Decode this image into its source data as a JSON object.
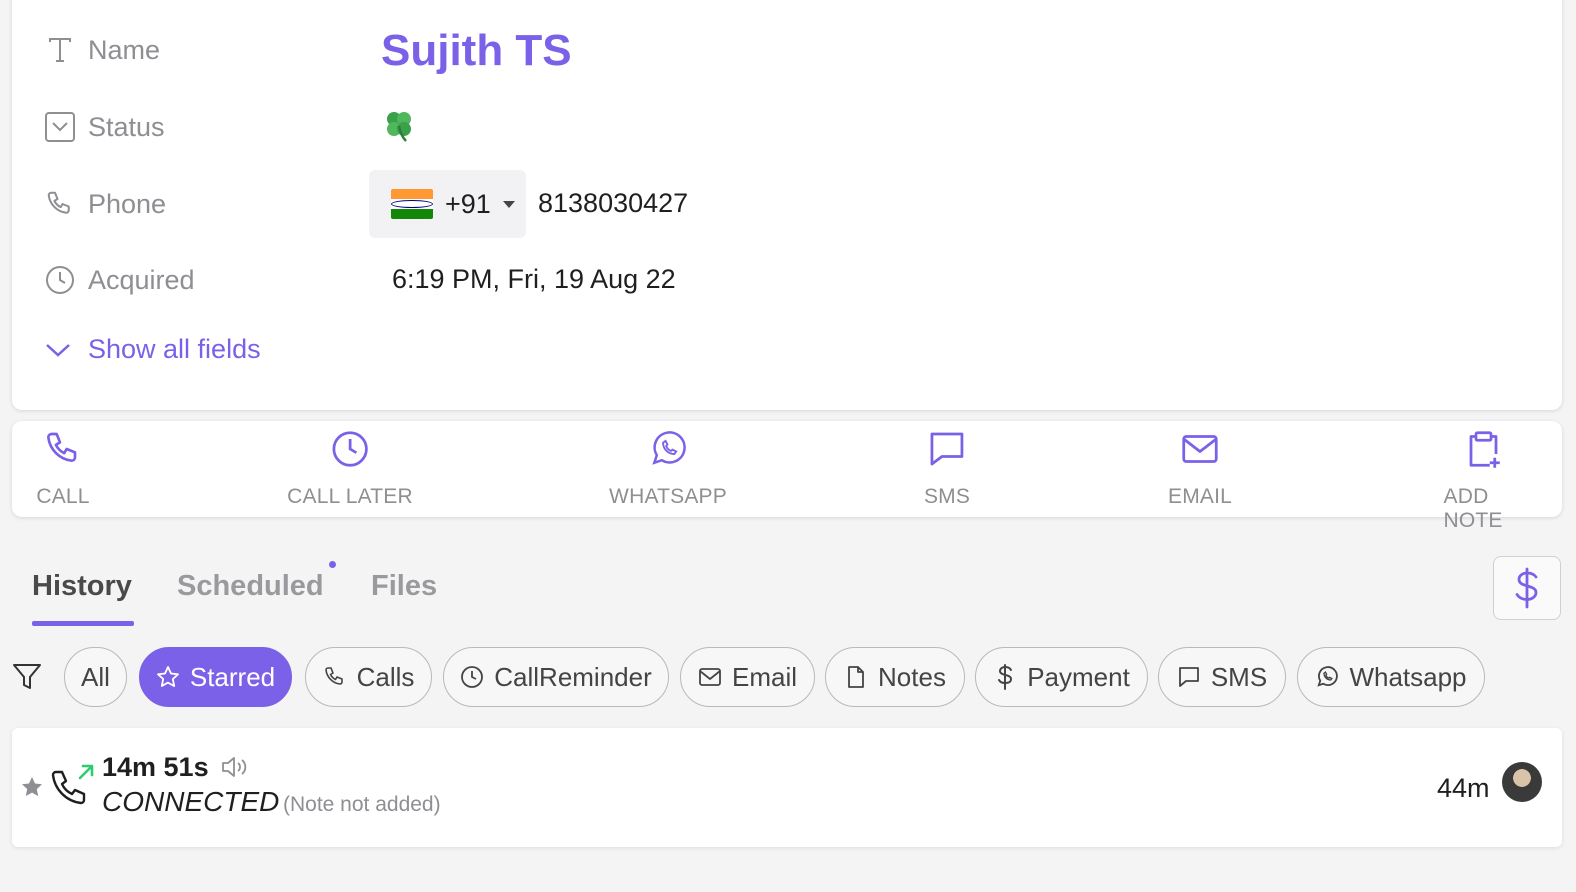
{
  "contact": {
    "fields": {
      "name_label": "Name",
      "status_label": "Status",
      "phone_label": "Phone",
      "acquired_label": "Acquired"
    },
    "name": "Sujith TS",
    "status_icon": "four-leaf-clover-icon",
    "phone": {
      "country_flag": "india-flag-icon",
      "country_code": "+91",
      "number": "8138030427"
    },
    "acquired": "6:19 PM, Fri, 19 Aug 22",
    "show_all_label": "Show all fields"
  },
  "actions": [
    {
      "label": "CALL",
      "icon": "phone-icon"
    },
    {
      "label": "CALL LATER",
      "icon": "clock-icon"
    },
    {
      "label": "WHATSAPP",
      "icon": "whatsapp-icon"
    },
    {
      "label": "SMS",
      "icon": "chat-bubble-icon"
    },
    {
      "label": "EMAIL",
      "icon": "envelope-icon"
    },
    {
      "label": "ADD NOTE",
      "icon": "clipboard-plus-icon"
    }
  ],
  "tabs": [
    {
      "label": "History",
      "active": true
    },
    {
      "label": "Scheduled",
      "active": false
    },
    {
      "label": "Files",
      "active": false
    }
  ],
  "filters": [
    {
      "label": "All",
      "icon": "",
      "selected": false
    },
    {
      "label": "Starred",
      "icon": "star-icon",
      "selected": true
    },
    {
      "label": "Calls",
      "icon": "phone-icon",
      "selected": false
    },
    {
      "label": "CallReminder",
      "icon": "clock-icon",
      "selected": false
    },
    {
      "label": "Email",
      "icon": "envelope-icon",
      "selected": false
    },
    {
      "label": "Notes",
      "icon": "document-icon",
      "selected": false
    },
    {
      "label": "Payment",
      "icon": "dollar-icon",
      "selected": false
    },
    {
      "label": "SMS",
      "icon": "chat-bubble-icon",
      "selected": false
    },
    {
      "label": "Whatsapp",
      "icon": "whatsapp-icon",
      "selected": false
    }
  ],
  "history": [
    {
      "duration": "14m 51s",
      "status": "CONNECTED",
      "note": "(Note not added)",
      "time_ago": "44m",
      "direction_icon": "outgoing-call-icon"
    }
  ],
  "colors": {
    "accent": "#7b61e8",
    "outgoing_arrow": "#2ecc71",
    "muted_text": "#8e8e93"
  }
}
